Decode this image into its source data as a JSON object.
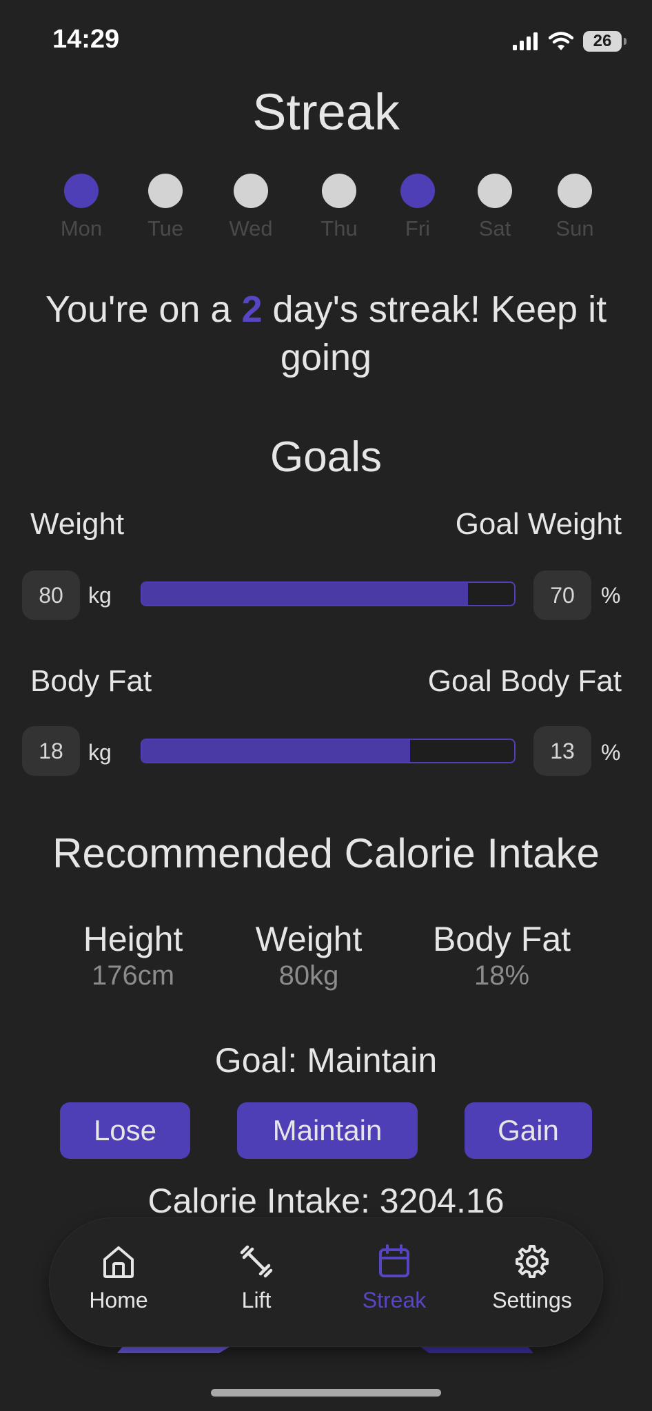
{
  "status_bar": {
    "time": "14:29",
    "battery": "26"
  },
  "streak": {
    "title": "Streak",
    "days": [
      {
        "label": "Mon",
        "active": true
      },
      {
        "label": "Tue",
        "active": false
      },
      {
        "label": "Wed",
        "active": false
      },
      {
        "label": "Thu",
        "active": false
      },
      {
        "label": "Fri",
        "active": true
      },
      {
        "label": "Sat",
        "active": false
      },
      {
        "label": "Sun",
        "active": false
      }
    ],
    "message_prefix": "You're on a ",
    "count": "2",
    "message_suffix": " day's streak! Keep it going"
  },
  "goals": {
    "title": "Goals",
    "weight": {
      "label": "Weight",
      "goal_label": "Goal Weight",
      "value": "80",
      "unit": "kg",
      "goal": "70",
      "goal_unit": "%",
      "progress": 0.875
    },
    "body_fat": {
      "label": "Body Fat",
      "goal_label": "Goal Body Fat",
      "value": "18",
      "unit": "kg",
      "goal": "13",
      "goal_unit": "%",
      "progress": 0.72
    }
  },
  "calorie": {
    "title": "Recommended Calorie Intake",
    "stats": [
      {
        "label": "Height",
        "value": "176cm"
      },
      {
        "label": "Weight",
        "value": "80kg"
      },
      {
        "label": "Body Fat",
        "value": "18%"
      }
    ],
    "goal_line": "Goal: Maintain",
    "buttons": {
      "lose": "Lose",
      "maintain": "Maintain",
      "gain": "Gain"
    },
    "intake_line": "Calorie Intake: 3204.16"
  },
  "nav": {
    "items": [
      {
        "label": "Home",
        "icon": "home-icon"
      },
      {
        "label": "Lift",
        "icon": "dumbbell-icon"
      },
      {
        "label": "Streak",
        "icon": "calendar-icon"
      },
      {
        "label": "Settings",
        "icon": "gear-icon"
      }
    ],
    "active": "Streak"
  },
  "colors": {
    "accent": "#4f3fb6",
    "background": "#222222",
    "inactive_dot": "#d3d3d3"
  }
}
